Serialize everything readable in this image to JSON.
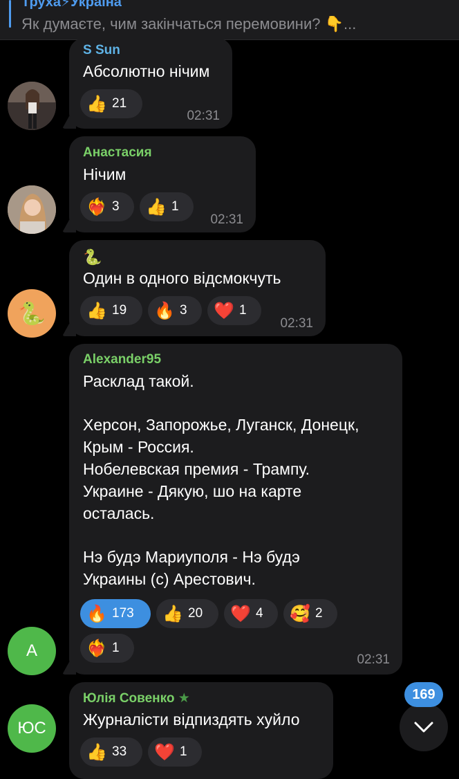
{
  "reply": {
    "title": "Труха⚡Україна",
    "text": "Як думаєте, чим закінчаться перемовини? 👇..."
  },
  "messages": [
    {
      "sender": "S Sun",
      "text": "Абсолютно нічим",
      "time": "02:31",
      "reactions": [
        {
          "emoji": "👍",
          "count": "21"
        }
      ]
    },
    {
      "sender": "Анастасия",
      "text": "Нічим",
      "time": "02:31",
      "reactions": [
        {
          "emoji": "❤️‍🔥",
          "count": "3"
        },
        {
          "emoji": "👍",
          "count": "1"
        }
      ]
    },
    {
      "sender": "🐍",
      "text": "Один в одного відсмокчуть",
      "time": "02:31",
      "reactions": [
        {
          "emoji": "👍",
          "count": "19"
        },
        {
          "emoji": "🔥",
          "count": "3"
        },
        {
          "emoji": "❤️",
          "count": "1"
        }
      ]
    },
    {
      "sender": "Alexander95",
      "lines": [
        "Расклад такой.",
        "",
        "Херсон, Запорожье, Луганск, Донецк,",
        "Крым - Россия.",
        "Нобелевская премия - Трампу.",
        "Украине - Дякую, шо на карте",
        "осталась.",
        "",
        "Нэ будэ Мариуполя - Нэ будэ",
        "Украины (с) Арестович."
      ],
      "time": "02:31",
      "reactions": [
        {
          "emoji": "🔥",
          "count": "173",
          "active": true
        },
        {
          "emoji": "👍",
          "count": "20"
        },
        {
          "emoji": "❤️",
          "count": "4"
        },
        {
          "emoji": "🥰",
          "count": "2"
        },
        {
          "emoji": "❤️‍🔥",
          "count": "1"
        }
      ],
      "avatar_initials": "A"
    },
    {
      "sender": "Юлія Совенко",
      "sender_badge": "★",
      "text": "Журналісти відпиздять хуйло",
      "reactions": [
        {
          "emoji": "👍",
          "count": "33"
        },
        {
          "emoji": "❤️",
          "count": "1"
        }
      ],
      "avatar_initials": "ЮС"
    }
  ],
  "unread_count": "169",
  "colors": {
    "background": "#000000",
    "bubble": "#1c1c1e",
    "sender_name": "#7ad068",
    "accent": "#3d8fe0",
    "muted": "#8c8c90"
  }
}
